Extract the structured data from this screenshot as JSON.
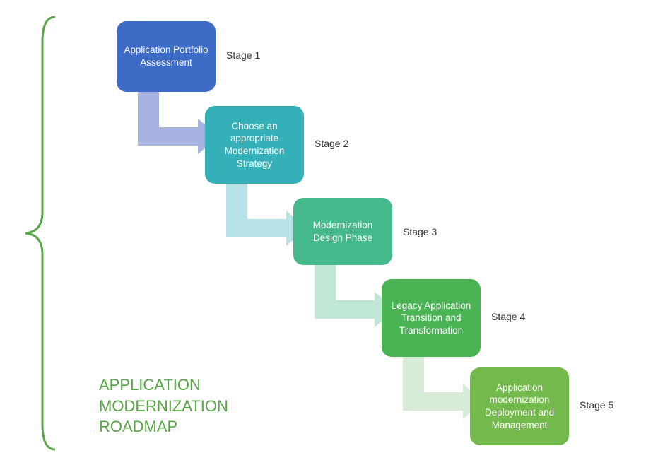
{
  "title_lines": [
    "APPLICATION",
    "MODERNIZATION",
    "ROADMAP"
  ],
  "stages": [
    {
      "id": "stage1",
      "box_text": "Application Portfolio Assessment",
      "label": "Stage 1",
      "color": "#3d6bc6",
      "arrow_color": "#a6b3e0"
    },
    {
      "id": "stage2",
      "box_text": "Choose an appropriate Modernization Strategy",
      "label": "Stage 2",
      "color": "#35b0b8",
      "arrow_color": "#b8e3e6"
    },
    {
      "id": "stage3",
      "box_text": "Modernization Design Phase",
      "label": "Stage 3",
      "color": "#45b98b",
      "arrow_color": "#c0e6d6"
    },
    {
      "id": "stage4",
      "box_text": "Legacy Application Transition and Transformation",
      "label": "Stage 4",
      "color": "#4ab454",
      "arrow_color": "#d6ecd6"
    },
    {
      "id": "stage5",
      "box_text": "Application modernization Deployment and Management",
      "label": "Stage 5",
      "color": "#74b94c",
      "arrow_color": null
    }
  ],
  "colors": {
    "bracket": "#57a646",
    "title": "#57a646",
    "label": "#333333"
  }
}
